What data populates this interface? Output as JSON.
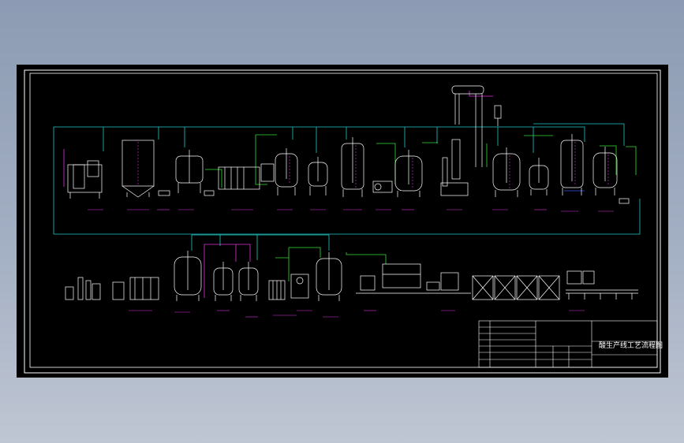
{
  "drawing": {
    "title": "酸生产线工艺流程图",
    "background": "#000000",
    "line_colors": {
      "equipment": "#ffffff",
      "pipe_green": "#33dd33",
      "pipe_cyan": "#22c7c7",
      "pipe_magenta": "#dd33dd",
      "pipe_blue": "#3355ff",
      "label": "#e05ce0",
      "frame": "#ffffff"
    }
  }
}
